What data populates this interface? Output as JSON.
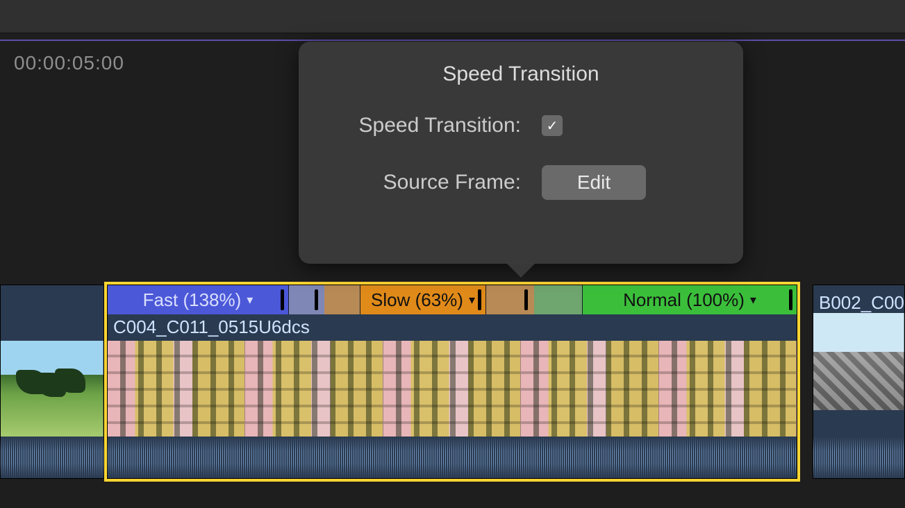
{
  "timeline": {
    "timecode": "00:00:05:00"
  },
  "popover": {
    "title": "Speed Transition",
    "rows": {
      "transition_label": "Speed Transition:",
      "transition_checked": "✓",
      "source_frame_label": "Source Frame:",
      "edit_button": "Edit"
    }
  },
  "clips": {
    "main_name": "C004_C011_0515U6dcs",
    "right_name": "B002_C00"
  },
  "speed_segments": {
    "fast": "Fast (138%)",
    "slow": "Slow (63%)",
    "normal": "Normal (100%)"
  }
}
